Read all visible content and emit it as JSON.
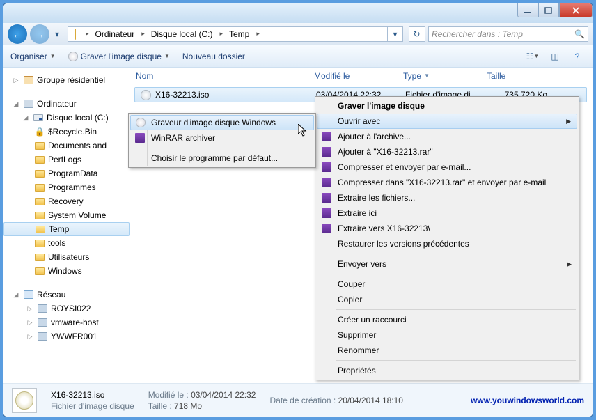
{
  "breadcrumb": {
    "segs": [
      "Ordinateur",
      "Disque local (C:)",
      "Temp"
    ]
  },
  "search": {
    "placeholder": "Rechercher dans : Temp"
  },
  "toolbar": {
    "organize": "Organiser",
    "burn": "Graver l'image disque",
    "newfolder": "Nouveau dossier"
  },
  "columns": {
    "name": "Nom",
    "modified": "Modifié le",
    "type": "Type",
    "size": "Taille"
  },
  "file": {
    "name": "X16-32213.iso",
    "modified": "03/04/2014 22:32",
    "type": "Fichier d'image di...",
    "size": "735 720 Ko"
  },
  "sidebar": {
    "group1": {
      "title": "Groupe résidentiel"
    },
    "group2": {
      "title": "Ordinateur",
      "drive": "Disque local (C:)",
      "folders": [
        "$Recycle.Bin",
        "Documents and",
        "PerfLogs",
        "ProgramData",
        "Programmes",
        "Recovery",
        "System Volume",
        "Temp",
        "tools",
        "Utilisateurs",
        "Windows"
      ]
    },
    "group3": {
      "title": "Réseau",
      "items": [
        "ROYSI022",
        "vmware-host",
        "YWWFR001"
      ]
    }
  },
  "status": {
    "filename": "X16-32213.iso",
    "filetype": "Fichier d'image disque",
    "mod_label": "Modifié le :",
    "mod_value": "03/04/2014 22:32",
    "size_label": "Taille :",
    "size_value": "718 Mo",
    "created_label": "Date de création :",
    "created_value": "20/04/2014 18:10",
    "link": "www.youwindowsworld.com"
  },
  "ctx_main": {
    "burn": "Graver l'image disque",
    "openwith": "Ouvrir avec",
    "add_archive": "Ajouter à l'archive...",
    "add_rar": "Ajouter à \"X16-32213.rar\"",
    "compress_mail": "Compresser et envoyer par e-mail...",
    "compress_rar_mail": "Compresser dans \"X16-32213.rar\" et envoyer par e-mail",
    "extract": "Extraire les fichiers...",
    "extract_here": "Extraire ici",
    "extract_to": "Extraire vers X16-32213\\",
    "restore": "Restaurer les versions précédentes",
    "sendto": "Envoyer vers",
    "cut": "Couper",
    "copy": "Copier",
    "shortcut": "Créer un raccourci",
    "delete": "Supprimer",
    "rename": "Renommer",
    "properties": "Propriétés"
  },
  "ctx_sub": {
    "burner": "Graveur d'image disque Windows",
    "winrar": "WinRAR archiver",
    "choose": "Choisir le programme par défaut..."
  }
}
